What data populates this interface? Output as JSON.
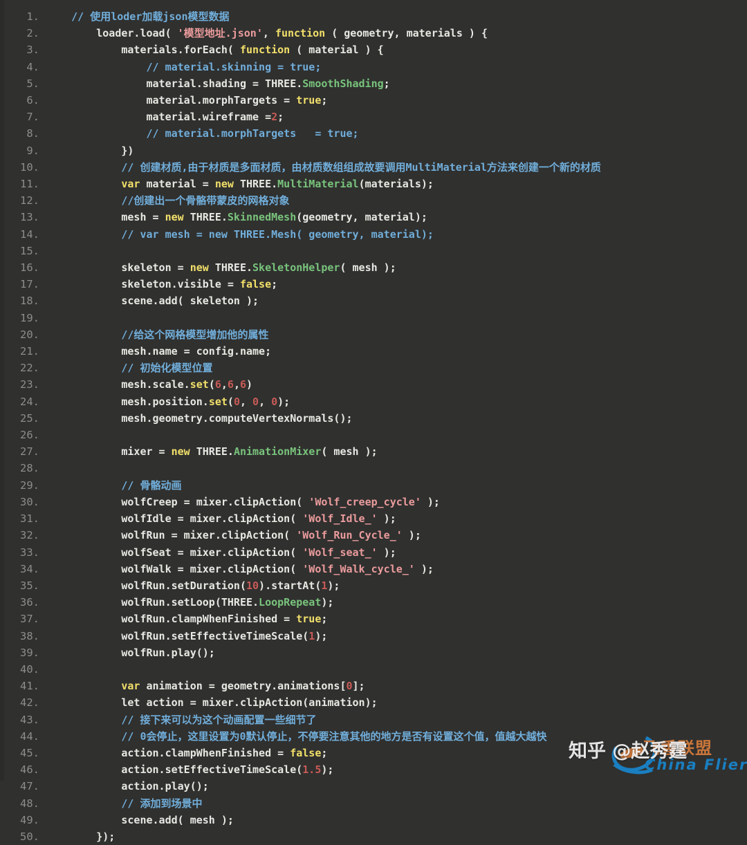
{
  "editor": {
    "background": "#30302f",
    "line_number_color": "#8d8d8b",
    "text_color": "#e8e8e3",
    "comment_color": "#71aeda",
    "keyword_color": "#f2e06a",
    "string_color": "#eb9c9c",
    "class_color": "#79c47c",
    "number_color": "#c75b56",
    "language": "javascript",
    "total_lines": 50
  },
  "lines": [
    {
      "num": "1.",
      "tokens": [
        {
          "t": "    ",
          "c": "plain"
        },
        {
          "t": "// 使用loder加载json模型数据",
          "c": "comment"
        }
      ]
    },
    {
      "num": "2.",
      "tokens": [
        {
          "t": "        loader.load( ",
          "c": "plain"
        },
        {
          "t": "'模型地址.json'",
          "c": "string"
        },
        {
          "t": ", ",
          "c": "plain"
        },
        {
          "t": "function",
          "c": "keyword"
        },
        {
          "t": " ( geometry, materials ) {",
          "c": "plain"
        }
      ]
    },
    {
      "num": "3.",
      "tokens": [
        {
          "t": "            materials.forEach( ",
          "c": "plain"
        },
        {
          "t": "function",
          "c": "keyword"
        },
        {
          "t": " ( material ) {",
          "c": "plain"
        }
      ]
    },
    {
      "num": "4.",
      "tokens": [
        {
          "t": "                ",
          "c": "plain"
        },
        {
          "t": "// material.skinning = true;",
          "c": "comment"
        }
      ]
    },
    {
      "num": "5.",
      "tokens": [
        {
          "t": "                material.shading = THREE.",
          "c": "plain"
        },
        {
          "t": "SmoothShading",
          "c": "class"
        },
        {
          "t": ";",
          "c": "plain"
        }
      ]
    },
    {
      "num": "6.",
      "tokens": [
        {
          "t": "                material.morphTargets = ",
          "c": "plain"
        },
        {
          "t": "true",
          "c": "keyword"
        },
        {
          "t": ";",
          "c": "plain"
        }
      ]
    },
    {
      "num": "7.",
      "tokens": [
        {
          "t": "                material.wireframe =",
          "c": "plain"
        },
        {
          "t": "2",
          "c": "number"
        },
        {
          "t": ";",
          "c": "plain"
        }
      ]
    },
    {
      "num": "8.",
      "tokens": [
        {
          "t": "                ",
          "c": "plain"
        },
        {
          "t": "// material.morphTargets   = true;",
          "c": "comment"
        }
      ]
    },
    {
      "num": "9.",
      "tokens": [
        {
          "t": "            })",
          "c": "plain"
        }
      ]
    },
    {
      "num": "10.",
      "tokens": [
        {
          "t": "            ",
          "c": "plain"
        },
        {
          "t": "// 创建材质,由于材质是多面材质，由材质数组组成故要调用MultiMaterial方法来创建一个新的材质",
          "c": "comment"
        }
      ]
    },
    {
      "num": "11.",
      "tokens": [
        {
          "t": "            ",
          "c": "plain"
        },
        {
          "t": "var",
          "c": "keyword"
        },
        {
          "t": " material = ",
          "c": "plain"
        },
        {
          "t": "new",
          "c": "keyword"
        },
        {
          "t": " THREE.",
          "c": "plain"
        },
        {
          "t": "MultiMaterial",
          "c": "class"
        },
        {
          "t": "(materials);",
          "c": "plain"
        }
      ]
    },
    {
      "num": "12.",
      "tokens": [
        {
          "t": "            ",
          "c": "plain"
        },
        {
          "t": "//创建出一个骨骼带蒙皮的网格对象",
          "c": "comment"
        }
      ]
    },
    {
      "num": "13.",
      "tokens": [
        {
          "t": "            mesh = ",
          "c": "plain"
        },
        {
          "t": "new",
          "c": "keyword"
        },
        {
          "t": " THREE.",
          "c": "plain"
        },
        {
          "t": "SkinnedMesh",
          "c": "class"
        },
        {
          "t": "(geometry, material);",
          "c": "plain"
        }
      ]
    },
    {
      "num": "14.",
      "tokens": [
        {
          "t": "            ",
          "c": "plain"
        },
        {
          "t": "// var mesh = new THREE.Mesh( geometry, material);",
          "c": "comment"
        }
      ]
    },
    {
      "num": "15.",
      "tokens": [
        {
          "t": "",
          "c": "plain"
        }
      ]
    },
    {
      "num": "16.",
      "tokens": [
        {
          "t": "            skeleton = ",
          "c": "plain"
        },
        {
          "t": "new",
          "c": "keyword"
        },
        {
          "t": " THREE.",
          "c": "plain"
        },
        {
          "t": "SkeletonHelper",
          "c": "class"
        },
        {
          "t": "( mesh );",
          "c": "plain"
        }
      ]
    },
    {
      "num": "17.",
      "tokens": [
        {
          "t": "            skeleton.visible = ",
          "c": "plain"
        },
        {
          "t": "false",
          "c": "keyword"
        },
        {
          "t": ";",
          "c": "plain"
        }
      ]
    },
    {
      "num": "18.",
      "tokens": [
        {
          "t": "            scene.add( skeleton );",
          "c": "plain"
        }
      ]
    },
    {
      "num": "19.",
      "tokens": [
        {
          "t": "",
          "c": "plain"
        }
      ]
    },
    {
      "num": "20.",
      "tokens": [
        {
          "t": "            ",
          "c": "plain"
        },
        {
          "t": "//给这个网格模型增加他的属性",
          "c": "comment"
        }
      ]
    },
    {
      "num": "21.",
      "tokens": [
        {
          "t": "            mesh.name = config.name;",
          "c": "plain"
        }
      ]
    },
    {
      "num": "22.",
      "tokens": [
        {
          "t": "            ",
          "c": "plain"
        },
        {
          "t": "// 初始化模型位置",
          "c": "comment"
        }
      ]
    },
    {
      "num": "23.",
      "tokens": [
        {
          "t": "            mesh.scale.",
          "c": "plain"
        },
        {
          "t": "set",
          "c": "func"
        },
        {
          "t": "(",
          "c": "plain"
        },
        {
          "t": "6",
          "c": "number"
        },
        {
          "t": ",",
          "c": "plain"
        },
        {
          "t": "6",
          "c": "number"
        },
        {
          "t": ",",
          "c": "plain"
        },
        {
          "t": "6",
          "c": "number"
        },
        {
          "t": ")",
          "c": "plain"
        }
      ]
    },
    {
      "num": "24.",
      "tokens": [
        {
          "t": "            mesh.position.",
          "c": "plain"
        },
        {
          "t": "set",
          "c": "func"
        },
        {
          "t": "(",
          "c": "plain"
        },
        {
          "t": "0",
          "c": "number"
        },
        {
          "t": ", ",
          "c": "plain"
        },
        {
          "t": "0",
          "c": "number"
        },
        {
          "t": ", ",
          "c": "plain"
        },
        {
          "t": "0",
          "c": "number"
        },
        {
          "t": ");",
          "c": "plain"
        }
      ]
    },
    {
      "num": "25.",
      "tokens": [
        {
          "t": "            mesh.geometry.computeVertexNormals();",
          "c": "plain"
        }
      ]
    },
    {
      "num": "26.",
      "tokens": [
        {
          "t": "",
          "c": "plain"
        }
      ]
    },
    {
      "num": "27.",
      "tokens": [
        {
          "t": "            mixer = ",
          "c": "plain"
        },
        {
          "t": "new",
          "c": "keyword"
        },
        {
          "t": " THREE.",
          "c": "plain"
        },
        {
          "t": "AnimationMixer",
          "c": "class"
        },
        {
          "t": "( mesh );",
          "c": "plain"
        }
      ]
    },
    {
      "num": "28.",
      "tokens": [
        {
          "t": "",
          "c": "plain"
        }
      ]
    },
    {
      "num": "29.",
      "tokens": [
        {
          "t": "            ",
          "c": "plain"
        },
        {
          "t": "// 骨骼动画",
          "c": "comment"
        }
      ]
    },
    {
      "num": "30.",
      "tokens": [
        {
          "t": "            wolfCreep = mixer.clipAction( ",
          "c": "plain"
        },
        {
          "t": "'Wolf_creep_cycle'",
          "c": "string"
        },
        {
          "t": " );",
          "c": "plain"
        }
      ]
    },
    {
      "num": "31.",
      "tokens": [
        {
          "t": "            wolfIdle = mixer.clipAction( ",
          "c": "plain"
        },
        {
          "t": "'Wolf_Idle_'",
          "c": "string"
        },
        {
          "t": " );",
          "c": "plain"
        }
      ]
    },
    {
      "num": "32.",
      "tokens": [
        {
          "t": "            wolfRun = mixer.clipAction( ",
          "c": "plain"
        },
        {
          "t": "'Wolf_Run_Cycle_'",
          "c": "string"
        },
        {
          "t": " );",
          "c": "plain"
        }
      ]
    },
    {
      "num": "33.",
      "tokens": [
        {
          "t": "            wolfSeat = mixer.clipAction( ",
          "c": "plain"
        },
        {
          "t": "'Wolf_seat_'",
          "c": "string"
        },
        {
          "t": " );",
          "c": "plain"
        }
      ]
    },
    {
      "num": "34.",
      "tokens": [
        {
          "t": "            wolfWalk = mixer.clipAction( ",
          "c": "plain"
        },
        {
          "t": "'Wolf_Walk_cycle_'",
          "c": "string"
        },
        {
          "t": " );",
          "c": "plain"
        }
      ]
    },
    {
      "num": "35.",
      "tokens": [
        {
          "t": "            wolfRun.setDuration(",
          "c": "plain"
        },
        {
          "t": "10",
          "c": "number"
        },
        {
          "t": ").startAt(",
          "c": "plain"
        },
        {
          "t": "1",
          "c": "number"
        },
        {
          "t": ");",
          "c": "plain"
        }
      ]
    },
    {
      "num": "36.",
      "tokens": [
        {
          "t": "            wolfRun.setLoop(THREE.",
          "c": "plain"
        },
        {
          "t": "LoopRepeat",
          "c": "class"
        },
        {
          "t": ");",
          "c": "plain"
        }
      ]
    },
    {
      "num": "37.",
      "tokens": [
        {
          "t": "            wolfRun.clampWhenFinished = ",
          "c": "plain"
        },
        {
          "t": "true",
          "c": "keyword"
        },
        {
          "t": ";",
          "c": "plain"
        }
      ]
    },
    {
      "num": "38.",
      "tokens": [
        {
          "t": "            wolfRun.setEffectiveTimeScale(",
          "c": "plain"
        },
        {
          "t": "1",
          "c": "number"
        },
        {
          "t": ");",
          "c": "plain"
        }
      ]
    },
    {
      "num": "39.",
      "tokens": [
        {
          "t": "            wolfRun.play();",
          "c": "plain"
        }
      ]
    },
    {
      "num": "40.",
      "tokens": [
        {
          "t": "",
          "c": "plain"
        }
      ]
    },
    {
      "num": "41.",
      "tokens": [
        {
          "t": "            ",
          "c": "plain"
        },
        {
          "t": "var",
          "c": "keyword"
        },
        {
          "t": " animation = geometry.animations[",
          "c": "plain"
        },
        {
          "t": "0",
          "c": "number"
        },
        {
          "t": "];",
          "c": "plain"
        }
      ]
    },
    {
      "num": "42.",
      "tokens": [
        {
          "t": "            let action = mixer.clipAction(animation);",
          "c": "plain"
        }
      ]
    },
    {
      "num": "43.",
      "tokens": [
        {
          "t": "            ",
          "c": "plain"
        },
        {
          "t": "// 接下来可以为这个动画配置一些细节了",
          "c": "comment"
        }
      ]
    },
    {
      "num": "44.",
      "tokens": [
        {
          "t": "            ",
          "c": "plain"
        },
        {
          "t": "// 0会停止，这里设置为0默认停止，不停要注意其他的地方是否有设置这个值，值越大越快",
          "c": "comment"
        }
      ]
    },
    {
      "num": "45.",
      "tokens": [
        {
          "t": "            action.clampWhenFinished = ",
          "c": "plain"
        },
        {
          "t": "false",
          "c": "keyword"
        },
        {
          "t": ";",
          "c": "plain"
        }
      ]
    },
    {
      "num": "46.",
      "tokens": [
        {
          "t": "            action.setEffectiveTimeScale(",
          "c": "plain"
        },
        {
          "t": "1.5",
          "c": "number"
        },
        {
          "t": ");",
          "c": "plain"
        }
      ]
    },
    {
      "num": "47.",
      "tokens": [
        {
          "t": "            action.play();",
          "c": "plain"
        }
      ]
    },
    {
      "num": "48.",
      "tokens": [
        {
          "t": "            ",
          "c": "plain"
        },
        {
          "t": "// 添加到场景中",
          "c": "comment"
        }
      ]
    },
    {
      "num": "49.",
      "tokens": [
        {
          "t": "            scene.add( mesh );",
          "c": "plain"
        }
      ]
    },
    {
      "num": "50.",
      "tokens": [
        {
          "t": "        });",
          "c": "plain"
        }
      ]
    }
  ],
  "watermark": {
    "zhihu_text": "知乎 @赵秀霆",
    "logo_cn_text": "飞香联盟",
    "logo_en_text": "China Flier",
    "logo_blue": "#1a7fc1",
    "logo_orange": "#c8763a"
  }
}
